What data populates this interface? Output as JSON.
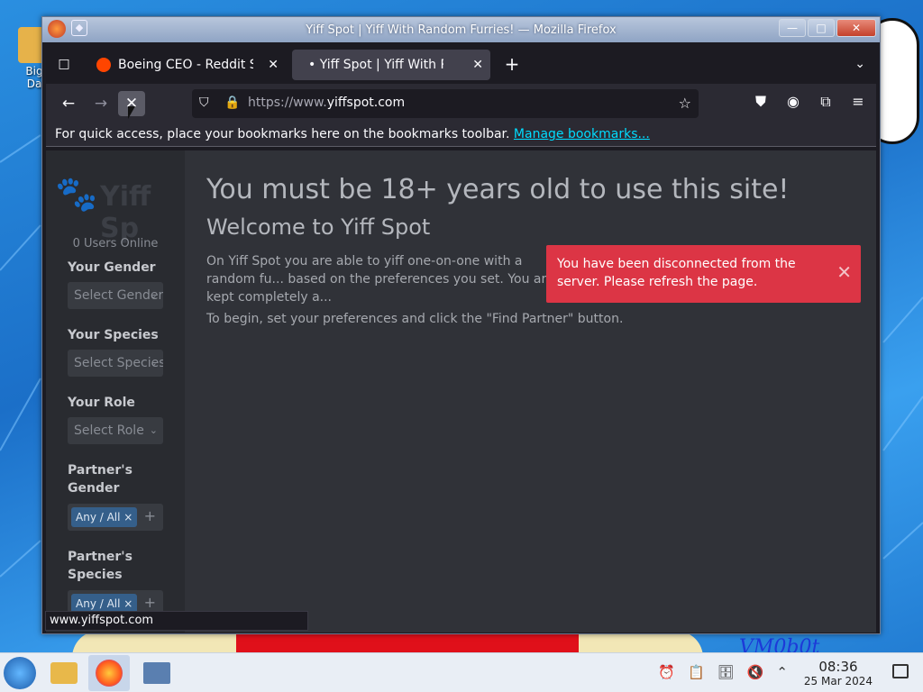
{
  "window": {
    "title": "Yiff Spot | Yiff With Random Furries! — Mozilla Firefox",
    "minimize": "—",
    "maximize": "□",
    "close": "✕"
  },
  "desktop": {
    "icon_label": "Big Da",
    "wallpaper_text": "VM0b0t"
  },
  "tabs": [
    {
      "label": "Boeing CEO - Reddit Search",
      "active": false
    },
    {
      "label": "• Yiff Spot | Yiff With Random Furries!",
      "active": true
    }
  ],
  "icons": {
    "tab_list": "□",
    "new_tab": "+",
    "tabs_menu": "⌄",
    "back": "←",
    "forward": "→",
    "stop": "✕",
    "shield": "⛉",
    "lock": "🔒",
    "star": "☆",
    "pocket": "⛊",
    "account": "◉",
    "extensions": "⧉",
    "menu": "≡",
    "toast_close": "✕",
    "select_chevron": "⌄",
    "tag_remove": "×",
    "add": "+"
  },
  "urlbar": {
    "scheme": "https://www.",
    "host": "yiffspot.com"
  },
  "bookmarks": {
    "message": "For quick access, place your bookmarks here on the bookmarks toolbar.",
    "link": "Manage bookmarks..."
  },
  "sidebar": {
    "brand": "Yiff Sp",
    "online": "0 Users Online",
    "your_gender_label": "Your Gender",
    "your_gender_value": "Select Gender",
    "your_species_label": "Your Species",
    "your_species_value": "Select Species",
    "your_role_label": "Your Role",
    "your_role_value": "Select Role",
    "partner_gender_label": "Partner's Gender",
    "partner_gender_tag": "Any / All",
    "partner_species_label": "Partner's Species",
    "partner_species_tag": "Any / All"
  },
  "content": {
    "heading": "You must be 18+ years old to use this site!",
    "welcome": "Welcome to Yiff Spot",
    "para1": "On Yiff Spot you are able to yiff one-on-one with a random fu... based on the preferences you set. You are kept completely a...",
    "para2": "To begin, set your preferences and click the \"Find Partner\" button."
  },
  "toast": {
    "message": "You have been disconnected from the server. Please refresh the page."
  },
  "status": {
    "url": "www.yiffspot.com"
  },
  "taskbar": {
    "time": "08:36",
    "date": "25 Mar 2024"
  }
}
